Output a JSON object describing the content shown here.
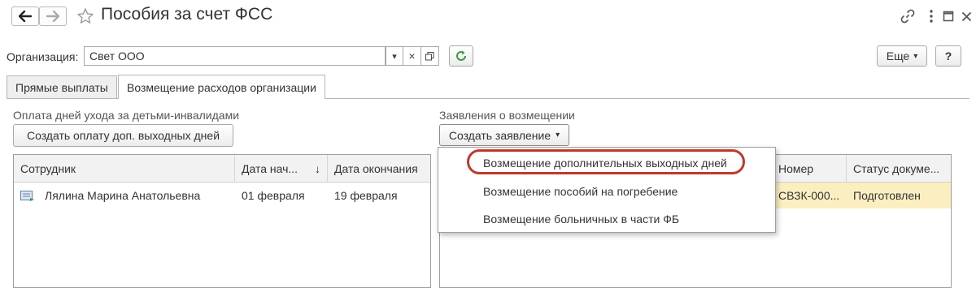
{
  "window": {
    "title": "Пособия за счет ФСС",
    "back_icon": "arrow-left-icon",
    "forward_icon": "arrow-right-icon",
    "favorite_icon": "star-icon",
    "link_icon": "link-icon",
    "menu_icon": "more-vertical-icon",
    "maximize_icon": "maximize-icon",
    "close_icon": "close-icon"
  },
  "organization": {
    "label": "Организация:",
    "value": "Свет ООО",
    "dropdown_glyph": "▾",
    "clear_glyph": "×",
    "open_icon": "open-window-icon",
    "refresh_icon": "refresh-icon"
  },
  "toolbar": {
    "more_label": "Еще",
    "more_glyph": "▾",
    "help_label": "?"
  },
  "tabs": [
    {
      "label": "Прямые выплаты",
      "active": false
    },
    {
      "label": "Возмещение расходов организации",
      "active": true
    }
  ],
  "left_group": {
    "title": "Оплата дней ухода за детьми-инвалидами",
    "create_button": "Создать оплату доп. выходных дней",
    "columns": [
      "Сотрудник",
      "Дата нач...",
      "Дата окончания"
    ],
    "sort_glyph": "↓",
    "rows": [
      {
        "employee": "Лялина Марина Анатольевна",
        "start": "01 февраля",
        "end": "19 февраля"
      }
    ]
  },
  "right_group": {
    "title": "Заявления о возмещении",
    "create_button": "Создать заявление",
    "create_glyph": "▾",
    "columns": [
      "Номер",
      "Статус докуме..."
    ],
    "rows": [
      {
        "number": "СВЗК-000...",
        "status": "Подготовлен"
      }
    ]
  },
  "dropdown_menu": {
    "items": [
      "Возмещение дополнительных выходных дней",
      "Возмещение пособий на погребение",
      "Возмещение больничных в части ФБ"
    ]
  },
  "colors": {
    "accent_highlight": "#c0392b",
    "selected_row": "#fbeec1",
    "refresh_green": "#3c9a3c"
  }
}
